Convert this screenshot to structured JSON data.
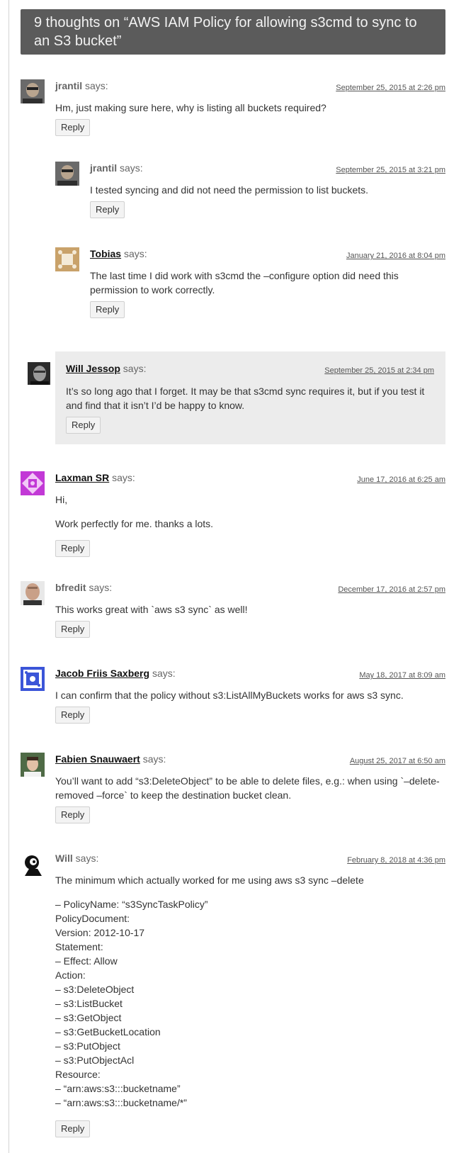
{
  "title": "9 thoughts on “AWS IAM Policy for allowing s3cmd to sync to an S3 bucket”",
  "says": "says:",
  "reply_label": "Reply",
  "comments": [
    {
      "author": "jrantil",
      "date": "September 25, 2015 at 2:26 pm",
      "text": "Hm, just making sure here, why is listing all buckets required?"
    },
    {
      "author": "jrantil",
      "date": "September 25, 2015 at 3:21 pm",
      "text": "I tested syncing and did not need the permission to list buckets."
    },
    {
      "author": "Tobias",
      "date": "January 21, 2016 at 8:04 pm",
      "text": "The last time I did work with s3cmd the –configure option did need this permission to work correctly."
    },
    {
      "author": "Will Jessop",
      "date": "September 25, 2015 at 2:34 pm",
      "text": "It’s so long ago that I forget. It may be that s3cmd sync requires it, but if you test it and find that it isn’t I’d be happy to know."
    },
    {
      "author": "Laxman SR",
      "date": "June 17, 2016 at 6:25 am",
      "p1": "Hi,",
      "p2": "Work perfectly for me. thanks a lots."
    },
    {
      "author": "bfredit",
      "date": "December 17, 2016 at 2:57 pm",
      "text": "This works great with `aws s3 sync` as well!"
    },
    {
      "author": "Jacob Friis Saxberg",
      "date": "May 18, 2017 at 8:09 am",
      "text": "I can confirm that the policy without s3:ListAllMyBuckets works for aws s3 sync."
    },
    {
      "author": "Fabien Snauwaert",
      "date": "August 25, 2017 at 6:50 am",
      "text": "You’ll want to add “s3:DeleteObject” to be able to delete files, e.g.: when using `–delete-removed –force` to keep the destination bucket clean."
    },
    {
      "author": "Will",
      "date": "February 8, 2018 at 4:36 pm",
      "text": "The minimum which actually worked for me using aws s3 sync –delete",
      "lines": [
        "– PolicyName: “s3SyncTaskPolicy”",
        "PolicyDocument:",
        "Version: 2012-10-17",
        "Statement:",
        "– Effect: Allow",
        "Action:",
        "– s3:DeleteObject",
        "– s3:ListBucket",
        "– s3:GetObject",
        "– s3:GetBucketLocation",
        "– s3:PutObject",
        "– s3:PutObjectAcl",
        "Resource:",
        "– “arn:aws:s3:::bucketname”",
        "– “arn:aws:s3:::bucketname/*”"
      ]
    }
  ]
}
